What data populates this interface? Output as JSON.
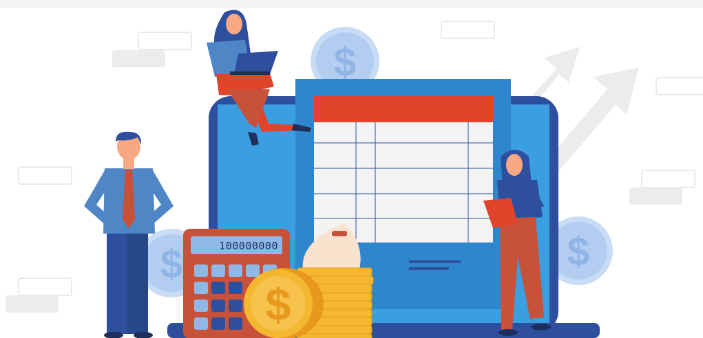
{
  "illustration": {
    "calculator_display": "100000000",
    "currency_symbol": "$"
  },
  "colors": {
    "topbar": "#f4f4f4",
    "laptop_frame": "#2d4f9e",
    "screen_blue": "#3b9ee0",
    "document_blue": "#2f86cc",
    "spreadsheet_header": "#e1442b",
    "spreadsheet_cells": "#f3f3f4",
    "calculator_body": "#c8513a",
    "coin_gold": "#f4b830",
    "coin_light_blue": "#c8dcf5",
    "arrow_gray": "#ececec",
    "skin": "#f8a882"
  }
}
